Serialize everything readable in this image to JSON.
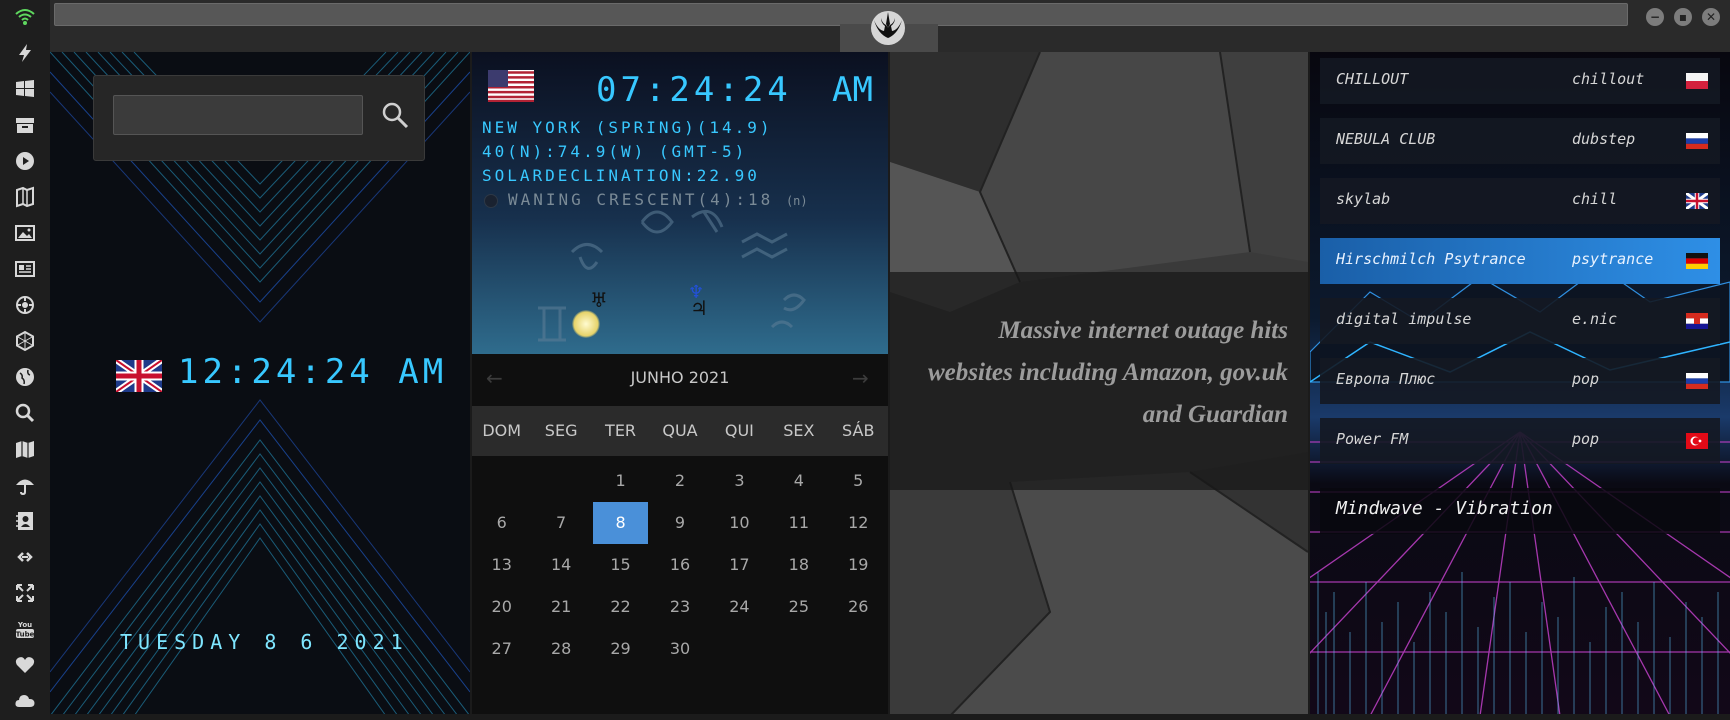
{
  "sidebar": {
    "icons": [
      "wifi-icon",
      "lightning-icon",
      "windows-icon",
      "archive-icon",
      "play-icon",
      "map-book-icon",
      "image-icon",
      "news-icon",
      "settings-wheel-icon",
      "hexagon-icon",
      "globe-icon",
      "search-icon",
      "map-icon",
      "umbrella-icon",
      "contacts-icon",
      "link-icon",
      "fullscreen-icon",
      "youtube-icon",
      "heart-icon",
      "cloud-icon"
    ]
  },
  "topbar": {
    "window_controls": [
      "−",
      "▪",
      "✕"
    ]
  },
  "clock_panel": {
    "search": {
      "value": "",
      "placeholder": ""
    },
    "uk_time": "12:24:24 AM",
    "date": "TUESDAY 8 6 2021"
  },
  "astro_panel": {
    "time": "07:24:24",
    "ampm": "AM",
    "line1": "NEW YORK (SPRING)(14.9)",
    "line2": "40(N):74.9(W) (GMT-5)",
    "line3": "SOLARDECLINATION:22.90",
    "moon": "WANING CRESCENT(4):18",
    "moon_suffix": "(n)"
  },
  "calendar": {
    "month": "JUNHO 2021",
    "prev": "←",
    "next": "→",
    "weekdays": [
      "DOM",
      "SEG",
      "TER",
      "QUA",
      "QUI",
      "SEX",
      "SÁB"
    ],
    "days": [
      "",
      "",
      "1",
      "2",
      "3",
      "4",
      "5",
      "6",
      "7",
      "8",
      "9",
      "10",
      "11",
      "12",
      "13",
      "14",
      "15",
      "16",
      "17",
      "18",
      "19",
      "20",
      "21",
      "22",
      "23",
      "24",
      "25",
      "26",
      "27",
      "28",
      "29",
      "30"
    ],
    "selected_day": "8",
    "accent": "#4a90d9"
  },
  "news": {
    "headline": "Massive internet outage hits websites including Amazon, gov.uk and Guardian"
  },
  "radio": {
    "stations": [
      {
        "name": "CHILLOUT",
        "genre": "chillout",
        "flag": "poland"
      },
      {
        "name": "NEBULA CLUB",
        "genre": "dubstep",
        "flag": "russia"
      },
      {
        "name": "skylab",
        "genre": "chill",
        "flag": "uk"
      },
      {
        "name": "Hirschmilch Psytrance",
        "genre": "psytrance",
        "flag": "germany"
      },
      {
        "name": "digital impulse",
        "genre": "e.nic",
        "flag": "croatia"
      },
      {
        "name": "Европа Плюс",
        "genre": "pop",
        "flag": "russia"
      },
      {
        "name": "Power FM",
        "genre": "pop",
        "flag": "turkey"
      }
    ],
    "active_index": 3,
    "now_playing": "Mindwave - Vibration"
  }
}
